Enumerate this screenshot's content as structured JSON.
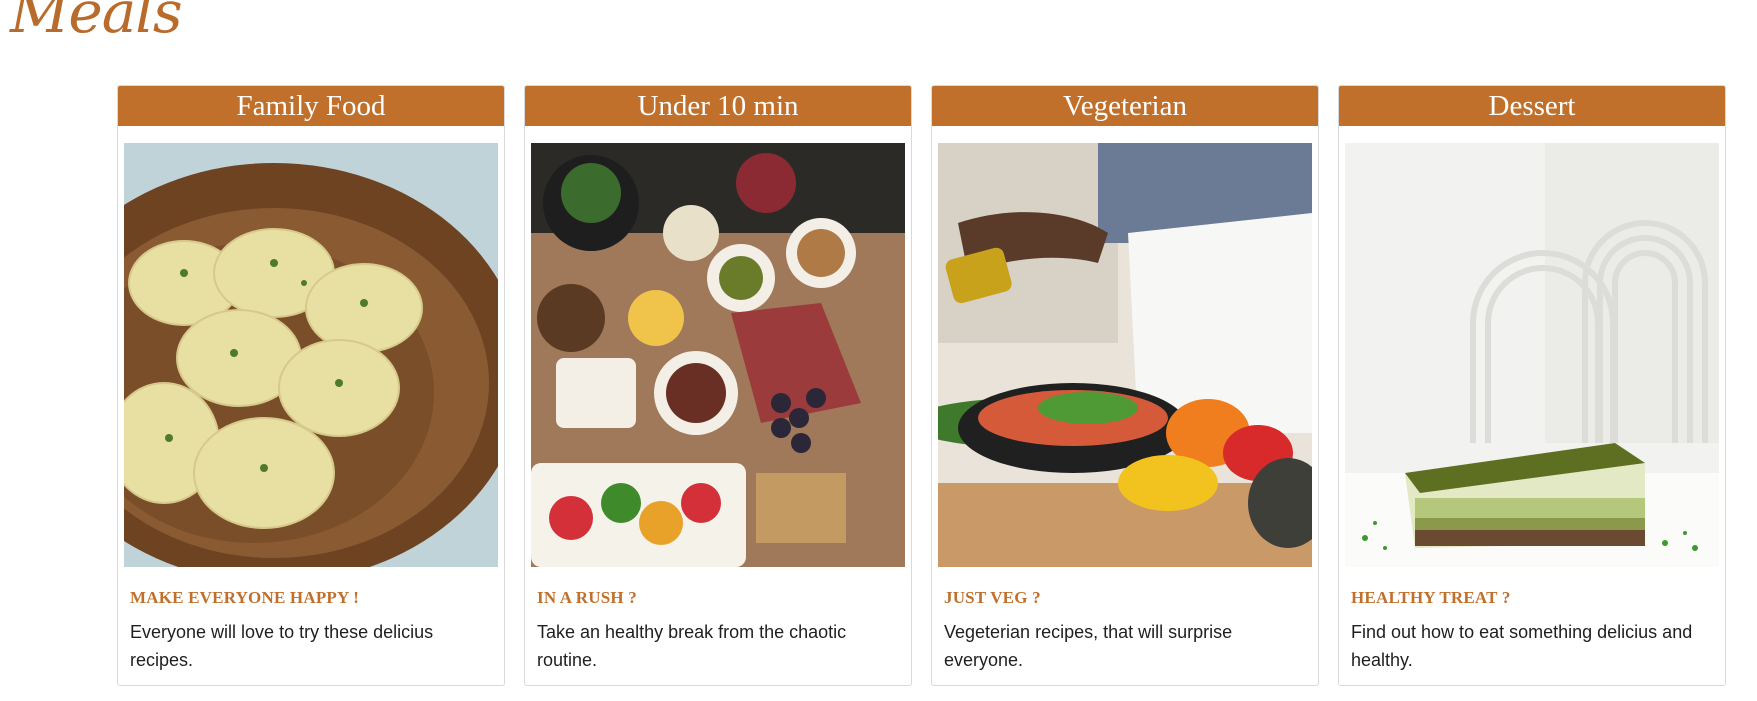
{
  "brand": {
    "logo_text": "Meals"
  },
  "cards": [
    {
      "title": "Family Food",
      "image_alt": "ravioli-bowl",
      "subtitle": "MAKE EVERYONE HAPPY !",
      "text": "Everyone will love to try these delicius recipes."
    },
    {
      "title": "Under 10 min",
      "image_alt": "appetizer-board",
      "subtitle": "IN A RUSH ?",
      "text": "Take an healthy break from the chaotic routine."
    },
    {
      "title": "Vegeterian",
      "image_alt": "vegetable-pan-olive-oil",
      "subtitle": "JUST VEG ?",
      "text": "Vegeterian recipes, that will surprise everyone."
    },
    {
      "title": "Dessert",
      "image_alt": "pistachio-cake-slice",
      "subtitle": "HEALTHY TREAT ?",
      "text": "Find out how to eat something delicius and healthy."
    }
  ],
  "colors": {
    "accent": "#c0702b",
    "logo": "#b96b2c"
  }
}
